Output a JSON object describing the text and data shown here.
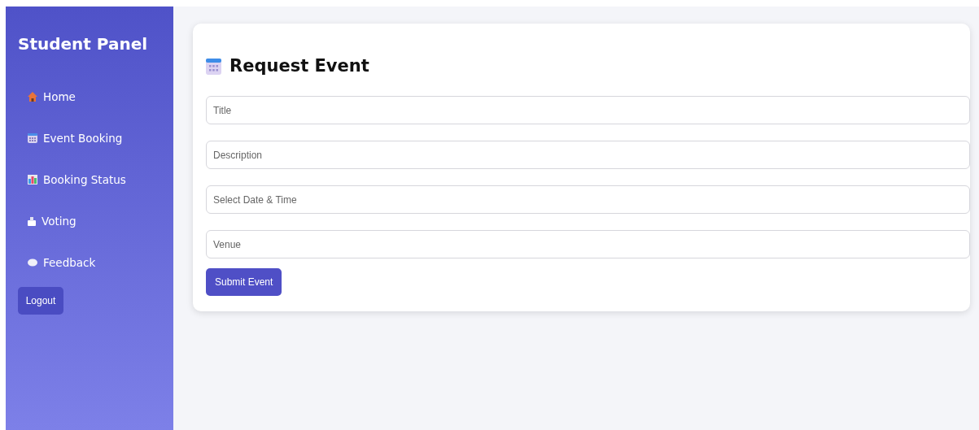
{
  "sidebar": {
    "title": "Student Panel",
    "items": [
      {
        "label": "Home"
      },
      {
        "label": "Event Booking"
      },
      {
        "label": "Booking Status"
      },
      {
        "label": "Voting"
      },
      {
        "label": "Feedback"
      }
    ],
    "logout": "Logout"
  },
  "form": {
    "title": "Request Event",
    "fields": [
      {
        "placeholder": "Title"
      },
      {
        "placeholder": "Description"
      },
      {
        "placeholder": "Select Date & Time"
      },
      {
        "placeholder": "Venue"
      }
    ],
    "submit": "Submit Event"
  }
}
